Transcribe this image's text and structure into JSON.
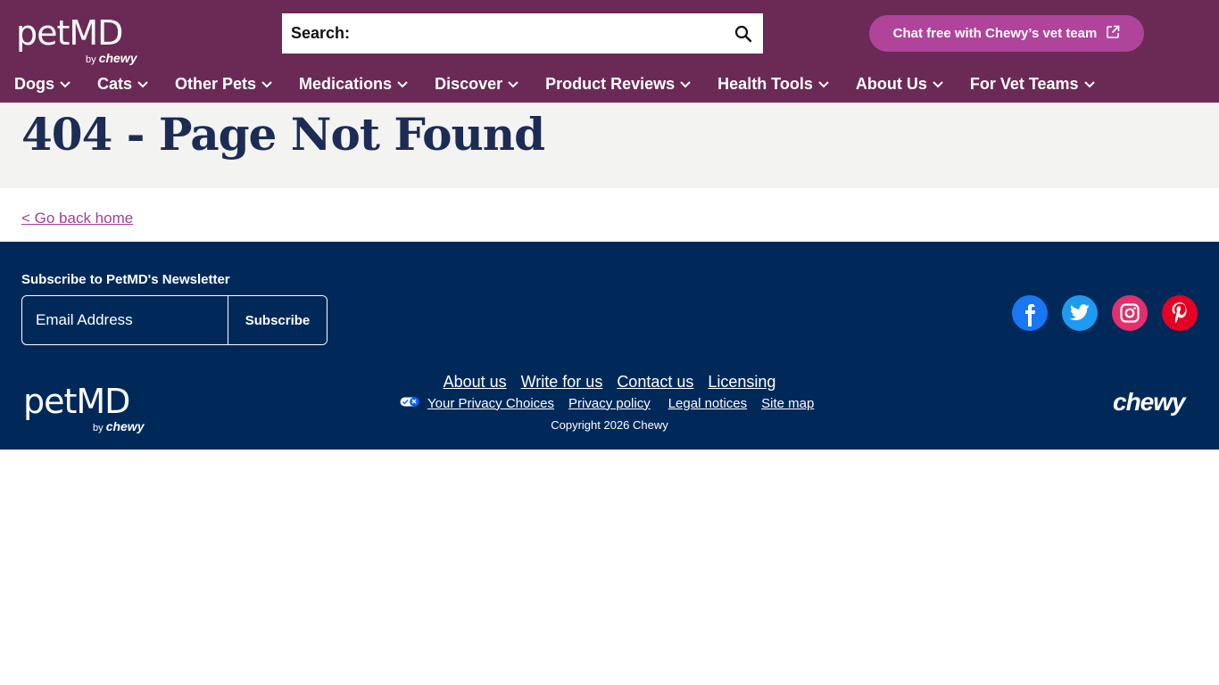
{
  "header": {
    "logo_main": "petMD",
    "logo_by": "by",
    "logo_brand": "chewy",
    "search_label": "Search:",
    "search_placeholder": "",
    "chat_label": "Chat free with Chewy’s vet team",
    "bg_color": "#6b2a55",
    "accent_color": "#b0449a"
  },
  "nav": {
    "items": [
      {
        "label": "Dogs"
      },
      {
        "label": "Cats"
      },
      {
        "label": "Other Pets"
      },
      {
        "label": "Medications"
      },
      {
        "label": "Discover"
      },
      {
        "label": "Product Reviews"
      },
      {
        "label": "Health Tools"
      },
      {
        "label": "About Us"
      },
      {
        "label": "For Vet Teams"
      }
    ]
  },
  "main": {
    "title": "404 - Page Not Found",
    "back_link": "< Go back home"
  },
  "footer": {
    "newsletter_title": "Subscribe to PetMD's Newsletter",
    "email_placeholder": "Email Address",
    "subscribe_label": "Subscribe",
    "social": [
      {
        "name": "facebook-icon",
        "color": "#1877f2"
      },
      {
        "name": "twitter-icon",
        "color": "#1d9bf0"
      },
      {
        "name": "instagram-icon",
        "color": "#e1306c"
      },
      {
        "name": "pinterest-icon",
        "color": "#e60023"
      }
    ],
    "links_primary": [
      {
        "label": "About us"
      },
      {
        "label": "Write for us"
      },
      {
        "label": "Contact us"
      },
      {
        "label": "Licensing"
      }
    ],
    "links_secondary": [
      {
        "label": "Your Privacy Choices"
      },
      {
        "label": "Privacy policy"
      },
      {
        "label": "Legal notices"
      },
      {
        "label": "Site map"
      }
    ],
    "copyright": "Copyright 2026 Chewy",
    "logo_main": "petMD",
    "logo_by": "by",
    "logo_brand": "chewy",
    "brand_logo": "chewy",
    "bg_color": "#00295a"
  }
}
